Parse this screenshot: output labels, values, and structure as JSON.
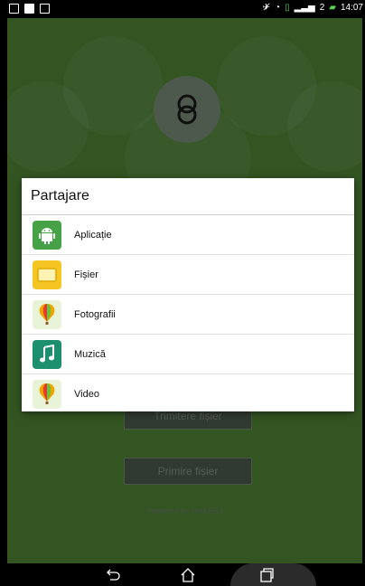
{
  "statusbar": {
    "time": "14:07",
    "sim_label": "2"
  },
  "app": {
    "send_button": "Trimitere fișier",
    "receive_button": "Primire fișier",
    "powered_by": "Powered by SHAREit"
  },
  "dialog": {
    "title": "Partajare",
    "items": [
      {
        "label": "Aplicație",
        "icon": "android-icon",
        "color": "#47a247"
      },
      {
        "label": "Fișier",
        "icon": "folder-icon",
        "color": "#f5c623"
      },
      {
        "label": "Fotografii",
        "icon": "photos-balloon-icon",
        "color": "#e9f3d8"
      },
      {
        "label": "Muzică",
        "icon": "music-icon",
        "color": "#1c8f6e"
      },
      {
        "label": "Video",
        "icon": "video-balloon-icon",
        "color": "#e9f3d8"
      }
    ]
  },
  "colors": {
    "app_background": "#5d9b3f",
    "dim_overlay": "rgba(0,0,0,0.45)"
  }
}
